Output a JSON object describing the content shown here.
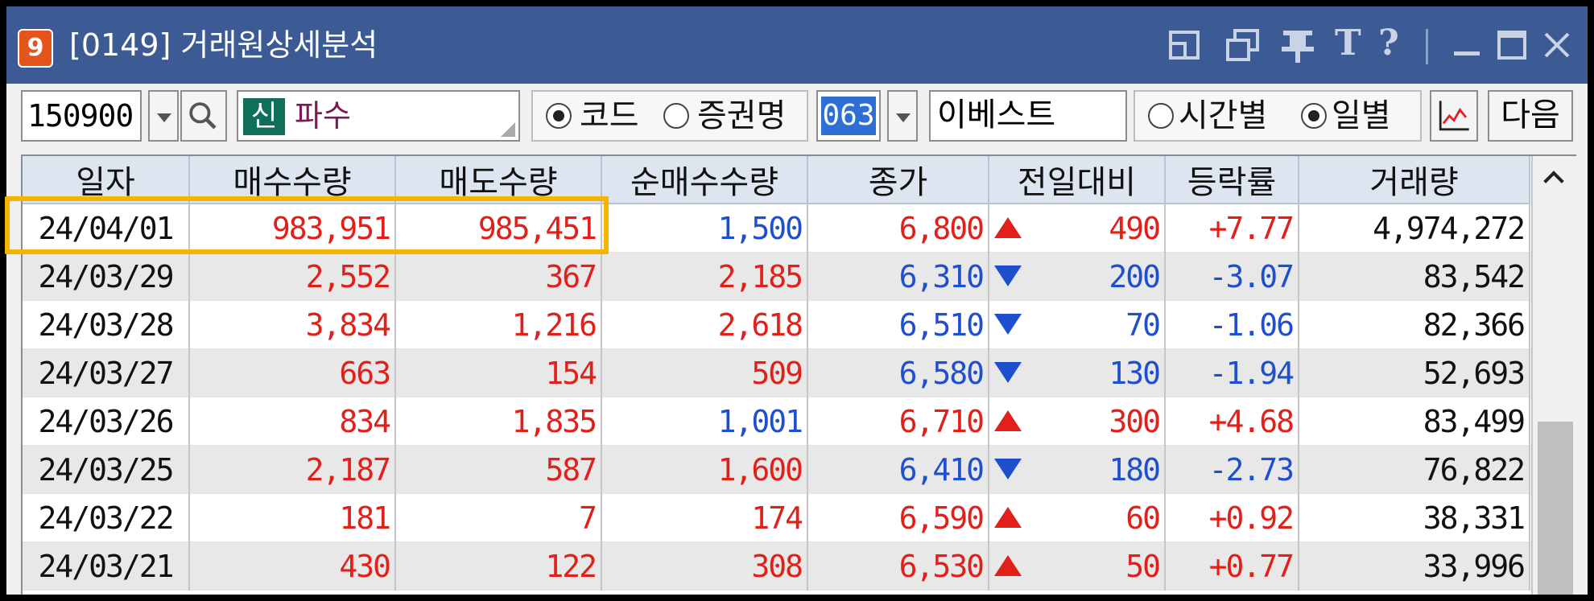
{
  "window": {
    "badge": "9",
    "title": "[0149] 거래원상세분석",
    "title_buttons": [
      "restore-layout-icon",
      "copy-window-icon",
      "pin-icon",
      "font-T-icon",
      "help-icon",
      "minimize-icon",
      "maximize-icon",
      "close-icon"
    ],
    "title_glyphs": {
      "font": "T",
      "help": "?"
    }
  },
  "toolbar": {
    "stock_code": "150900",
    "market_badge": "신",
    "stock_name": "파수",
    "search_mode_options": [
      {
        "label": "코드",
        "selected": true
      },
      {
        "label": "증권명",
        "selected": false
      }
    ],
    "broker_code": "063",
    "broker_name": "이베스트",
    "period_options": [
      {
        "label": "시간별",
        "selected": false
      },
      {
        "label": "일별",
        "selected": true
      }
    ],
    "next_label": "다음"
  },
  "table": {
    "columns": [
      "일자",
      "매수수량",
      "매도수량",
      "순매수수량",
      "종가",
      "전일대비",
      "등락률",
      "거래량"
    ],
    "rows": [
      {
        "date": "24/04/01",
        "buy": "983,951",
        "sell": "985,451",
        "net": "1,500",
        "net_dir": "blue",
        "close": "6,800",
        "dir": "up",
        "change": "490",
        "rate": "+7.77",
        "volume": "4,974,272"
      },
      {
        "date": "24/03/29",
        "buy": "2,552",
        "sell": "367",
        "net": "2,185",
        "net_dir": "red",
        "close": "6,310",
        "dir": "down",
        "change": "200",
        "rate": "-3.07",
        "volume": "83,542"
      },
      {
        "date": "24/03/28",
        "buy": "3,834",
        "sell": "1,216",
        "net": "2,618",
        "net_dir": "red",
        "close": "6,510",
        "dir": "down",
        "change": "70",
        "rate": "-1.06",
        "volume": "82,366"
      },
      {
        "date": "24/03/27",
        "buy": "663",
        "sell": "154",
        "net": "509",
        "net_dir": "red",
        "close": "6,580",
        "dir": "down",
        "change": "130",
        "rate": "-1.94",
        "volume": "52,693"
      },
      {
        "date": "24/03/26",
        "buy": "834",
        "sell": "1,835",
        "net": "1,001",
        "net_dir": "blue",
        "close": "6,710",
        "dir": "up",
        "change": "300",
        "rate": "+4.68",
        "volume": "83,499"
      },
      {
        "date": "24/03/25",
        "buy": "2,187",
        "sell": "587",
        "net": "1,600",
        "net_dir": "red",
        "close": "6,410",
        "dir": "down",
        "change": "180",
        "rate": "-2.73",
        "volume": "76,822"
      },
      {
        "date": "24/03/22",
        "buy": "181",
        "sell": "7",
        "net": "174",
        "net_dir": "red",
        "close": "6,590",
        "dir": "up",
        "change": "60",
        "rate": "+0.92",
        "volume": "38,331"
      },
      {
        "date": "24/03/21",
        "buy": "430",
        "sell": "122",
        "net": "308",
        "net_dir": "red",
        "close": "6,530",
        "dir": "up",
        "change": "50",
        "rate": "+0.77",
        "volume": "33,996"
      }
    ]
  },
  "colors": {
    "titlebar": "#3c5a93",
    "up": "#e2201a",
    "down": "#1e4fcf",
    "highlight": "#f5b400"
  }
}
